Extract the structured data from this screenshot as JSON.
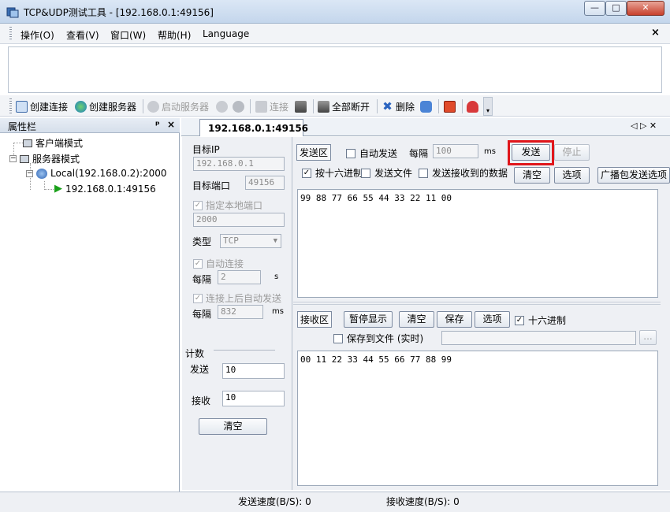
{
  "window": {
    "title": "TCP&UDP测试工具 - [192.168.0.1:49156]",
    "minimize_glyph": "—",
    "maximize_glyph": "□",
    "close_glyph": "✕"
  },
  "menu": {
    "items": [
      "操作(O)",
      "查看(V)",
      "窗口(W)",
      "帮助(H)",
      "Language"
    ],
    "close_glyph": "×"
  },
  "toolbar": {
    "create_connection": "创建连接",
    "create_server": "创建服务器",
    "start_server": "启动服务器",
    "connect": "连接",
    "disconnect_all": "全部断开",
    "delete": "删除"
  },
  "left_panel": {
    "title": "属性栏",
    "pin_glyph": "ᵖ",
    "close_glyph": "×",
    "tree": {
      "client_mode": "客户端模式",
      "server_mode": "服务器模式",
      "local": "Local(192.168.0.2):2000",
      "connection": "192.168.0.1:49156",
      "expand_glyph": "−"
    }
  },
  "tab": {
    "label": "192.168.0.1:49156",
    "nav_glyphs": "◁ ▷ ✕"
  },
  "settings": {
    "target_ip_label": "目标IP",
    "target_ip": "192.168.0.1",
    "target_port_label": "目标端口",
    "target_port": "49156",
    "bind_local_port_label": "指定本地端口",
    "local_port": "2000",
    "type_label": "类型",
    "type_value": "TCP",
    "auto_connect_label": "自动连接",
    "interval_label": "每隔",
    "interval_value": "2",
    "interval_unit": "s",
    "auto_send_label": "连接上后自动发送",
    "interval2_label": "每隔",
    "interval2_value": "832",
    "interval2_unit": "ms"
  },
  "counter": {
    "title": "计数",
    "send_label": "发送",
    "send_value": "10",
    "recv_label": "接收",
    "recv_value": "10",
    "clear_label": "清空"
  },
  "send": {
    "area_label": "发送区",
    "auto_send_label": "自动发送",
    "interval_label": "每隔",
    "interval_value": "100",
    "interval_unit": "ms",
    "send_button": "发送",
    "stop_button": "停止",
    "hex_label": "按十六进制",
    "send_file_label": "发送文件",
    "send_received_label": "发送接收到的数据",
    "clear_button": "清空",
    "options_button": "选项",
    "broadcast_button": "广播包发送选项",
    "content": "99 88 77 66 55 44 33 22 11 00"
  },
  "receive": {
    "area_label": "接收区",
    "pause_button": "暂停显示",
    "clear_button": "清空",
    "save_button": "保存",
    "options_button": "选项",
    "hex_label": "十六进制",
    "save_to_file_label": "保存到文件 (实时)",
    "browse_button": "...",
    "content": "00 11 22 33 44 55 66 77 88 99"
  },
  "status": {
    "send_speed": "发送速度(B/S): 0",
    "recv_speed": "接收速度(B/S): 0"
  },
  "colors": {
    "highlight_red": "#e0161b",
    "play_green": "#1aa01a"
  }
}
